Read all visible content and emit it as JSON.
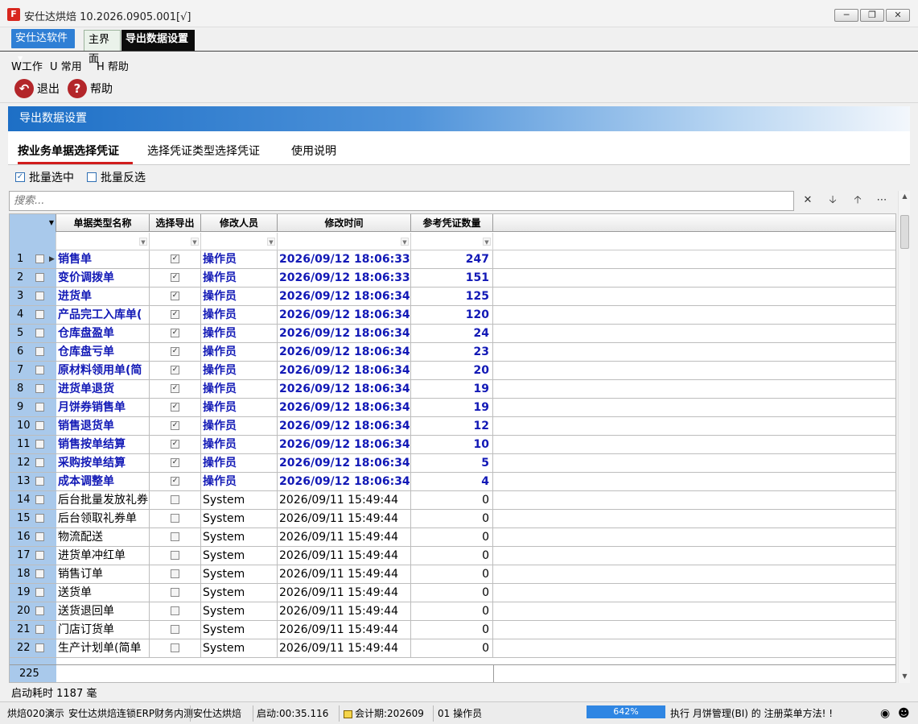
{
  "window": {
    "title": "安仕达烘焙  10.2026.0905.001[√]",
    "icon_label": "F"
  },
  "modules": {
    "brand": "安仕达软件",
    "tabs": [
      "主界面",
      "导出数据设置"
    ]
  },
  "menu": [
    "W工作",
    "U 常用",
    "H 帮助"
  ],
  "toolbar": {
    "exit_label": "退出",
    "help_label": "帮助"
  },
  "panel": {
    "title": "导出数据设置",
    "subtabs": [
      "按业务单据选择凭证",
      "选择凭证类型选择凭证",
      "使用说明"
    ]
  },
  "batch": {
    "select_all": "批量选中",
    "invert": "批量反选"
  },
  "search": {
    "placeholder": "搜索..."
  },
  "grid": {
    "columns": [
      "单据类型名称",
      "选择导出",
      "修改人员",
      "修改时间",
      "参考凭证数量"
    ],
    "rows": [
      {
        "no": "1",
        "name": "销售单",
        "checked": true,
        "user": "操作员",
        "time": "2026/09/12 18:06:33",
        "count": "247"
      },
      {
        "no": "2",
        "name": "变价调拨单",
        "checked": true,
        "user": "操作员",
        "time": "2026/09/12 18:06:33",
        "count": "151"
      },
      {
        "no": "3",
        "name": "进货单",
        "checked": true,
        "user": "操作员",
        "time": "2026/09/12 18:06:34",
        "count": "125"
      },
      {
        "no": "4",
        "name": "产品完工入库单(",
        "checked": true,
        "user": "操作员",
        "time": "2026/09/12 18:06:34",
        "count": "120"
      },
      {
        "no": "5",
        "name": "仓库盘盈单",
        "checked": true,
        "user": "操作员",
        "time": "2026/09/12 18:06:34",
        "count": "24"
      },
      {
        "no": "6",
        "name": "仓库盘亏单",
        "checked": true,
        "user": "操作员",
        "time": "2026/09/12 18:06:34",
        "count": "23"
      },
      {
        "no": "7",
        "name": "原材料领用单(简",
        "checked": true,
        "user": "操作员",
        "time": "2026/09/12 18:06:34",
        "count": "20"
      },
      {
        "no": "8",
        "name": "进货单退货",
        "checked": true,
        "user": "操作员",
        "time": "2026/09/12 18:06:34",
        "count": "19"
      },
      {
        "no": "9",
        "name": "月饼券销售单",
        "checked": true,
        "user": "操作员",
        "time": "2026/09/12 18:06:34",
        "count": "19"
      },
      {
        "no": "10",
        "name": "销售退货单",
        "checked": true,
        "user": "操作员",
        "time": "2026/09/12 18:06:34",
        "count": "12"
      },
      {
        "no": "11",
        "name": "销售按单结算",
        "checked": true,
        "user": "操作员",
        "time": "2026/09/12 18:06:34",
        "count": "10"
      },
      {
        "no": "12",
        "name": "采购按单结算",
        "checked": true,
        "user": "操作员",
        "time": "2026/09/12 18:06:34",
        "count": "5"
      },
      {
        "no": "13",
        "name": "成本调整单",
        "checked": true,
        "user": "操作员",
        "time": "2026/09/12 18:06:34",
        "count": "4"
      },
      {
        "no": "14",
        "name": "后台批量发放礼券",
        "checked": false,
        "user": "System",
        "time": "2026/09/11 15:49:44",
        "count": "0"
      },
      {
        "no": "15",
        "name": "后台领取礼券单",
        "checked": false,
        "user": "System",
        "time": "2026/09/11 15:49:44",
        "count": "0"
      },
      {
        "no": "16",
        "name": "物流配送",
        "checked": false,
        "user": "System",
        "time": "2026/09/11 15:49:44",
        "count": "0"
      },
      {
        "no": "17",
        "name": "进货单冲红单",
        "checked": false,
        "user": "System",
        "time": "2026/09/11 15:49:44",
        "count": "0"
      },
      {
        "no": "18",
        "name": "销售订单",
        "checked": false,
        "user": "System",
        "time": "2026/09/11 15:49:44",
        "count": "0"
      },
      {
        "no": "19",
        "name": "送货单",
        "checked": false,
        "user": "System",
        "time": "2026/09/11 15:49:44",
        "count": "0"
      },
      {
        "no": "20",
        "name": "送货退回单",
        "checked": false,
        "user": "System",
        "time": "2026/09/11 15:49:44",
        "count": "0"
      },
      {
        "no": "21",
        "name": "门店订货单",
        "checked": false,
        "user": "System",
        "time": "2026/09/11 15:49:44",
        "count": "0"
      },
      {
        "no": "22",
        "name": "生产计划单(简单",
        "checked": false,
        "user": "System",
        "time": "2026/09/11 15:49:44",
        "count": "0"
      }
    ],
    "footer_count": "225"
  },
  "load_time": "启动耗时  1187  毫",
  "status": {
    "company": "烘焙020演示",
    "product": "安仕达烘焙连锁ERP财务内测",
    "app": "安仕达烘焙",
    "startup": "启动:00:35.116",
    "period": "会计期:202609",
    "operator": "01 操作员",
    "progress": "642%",
    "progress_value": 1.0,
    "message": "执行  月饼管理(BI) 的 注册菜单方法! !"
  },
  "colors": {
    "accent_blue": "#2f7fd5",
    "selected_row_text": "#1219b6",
    "active_underline": "#d11d1d"
  }
}
